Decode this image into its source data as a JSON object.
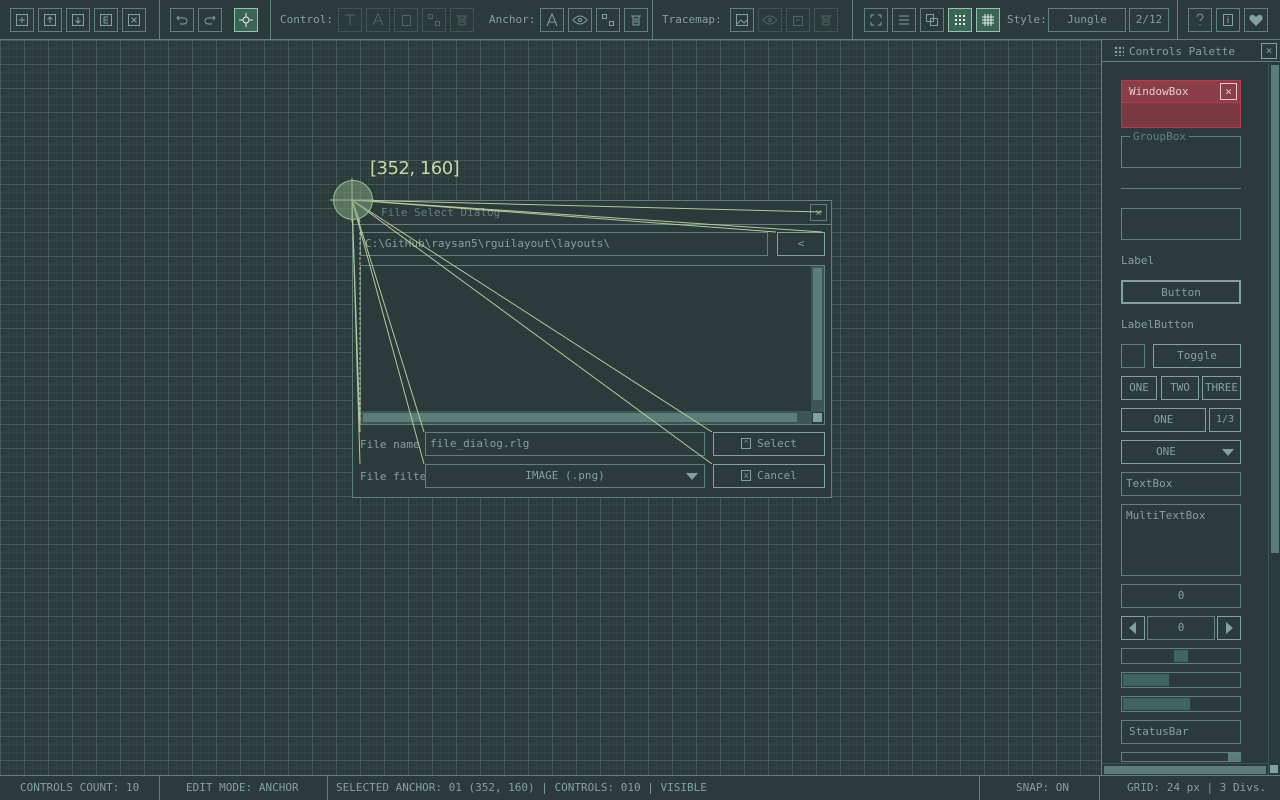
{
  "toolbar": {
    "file_buttons": [
      "new-file-icon",
      "load-file-icon",
      "save-file-icon",
      "export-file-icon",
      "close-file-icon"
    ],
    "undo_icon": "undo-icon",
    "redo_icon": "redo-icon",
    "snap_icon": "anchor-target-icon",
    "control_label": "Control:",
    "anchor_label": "Anchor:",
    "tracemap_label": "Tracemap:",
    "style_label": "Style:",
    "style_value": "Jungle",
    "style_index": "2/12",
    "help_icon": "help-icon",
    "info_icon": "info-icon",
    "heart_icon": "heart-icon"
  },
  "canvas": {
    "anchor_coord": "[352, 160]"
  },
  "dialog": {
    "title": "File Select Dialog",
    "close": "×",
    "path": "C:\\GitHub\\raysan5\\rguilayout\\layouts\\",
    "back": "<",
    "file_name_label": "File name",
    "file_name_value": "file_dialog.rlg",
    "file_filter_label": "File filte",
    "file_filter_value": "IMAGE (.png)",
    "select_label": "Select",
    "cancel_label": "Cancel"
  },
  "palette": {
    "title": "Controls Palette",
    "close": "×",
    "windowbox_label": "WindowBox",
    "windowbox_close": "×",
    "groupbox_label": "GroupBox",
    "label_label": "Label",
    "button_label": "Button",
    "labelbutton_label": "LabelButton",
    "toggle_label": "Toggle",
    "toggle_group": [
      "ONE",
      "TWO",
      "THREE"
    ],
    "combo_value": "ONE",
    "combo_index": "1/3",
    "dropdown_value": "ONE",
    "textbox_label": "TextBox",
    "multitextbox_label": "MultiTextBox",
    "valuebox_value": "0",
    "spinner_value": "0",
    "slider_value": 0.5,
    "sliderbar_value": 0.4,
    "progressbar_value": 0.58,
    "statusbar_label": "StatusBar"
  },
  "statusbar": {
    "controls_count": "CONTROLS COUNT: 10",
    "edit_mode": "EDIT MODE: ANCHOR",
    "selected": "SELECTED ANCHOR: 01  (352, 160) | CONTROLS: 010 | VISIBLE",
    "snap": "SNAP: ON",
    "grid": "GRID: 24 px | 3 Divs."
  },
  "colors": {
    "background": "#2b3a3a",
    "border": "#60827d",
    "text": "#82a29f",
    "accent": "#91c4a8",
    "selected_control": "#c0394a",
    "anchor_line": "#c6d8a6"
  }
}
